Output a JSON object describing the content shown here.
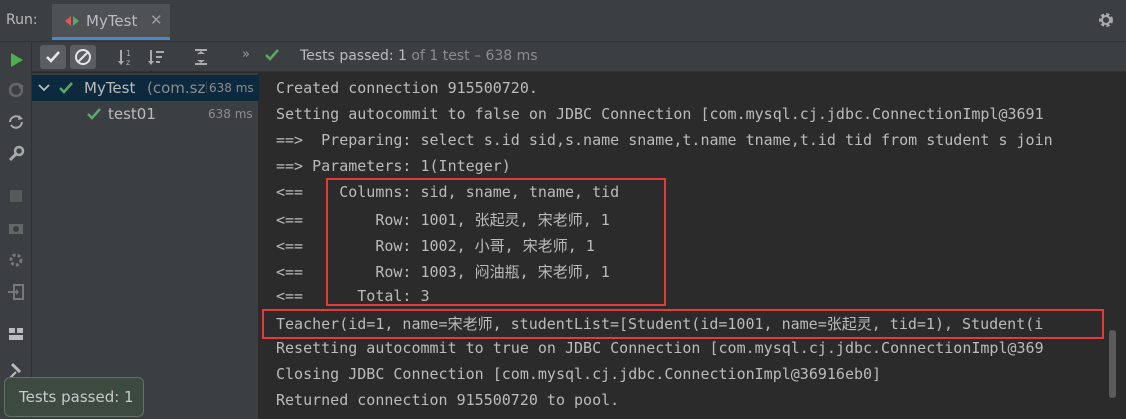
{
  "titlebar": {
    "run_label": "Run:",
    "tab_label": "MyTest",
    "tab_close": "✕"
  },
  "status": {
    "more": "»",
    "strong": "Tests passed:",
    "middle": " 1 ",
    "tail": "of 1 test – 638 ms"
  },
  "tree": {
    "root": {
      "label": "MyTest",
      "pkg": "(com.szh",
      "time": "638 ms"
    },
    "child": {
      "label": "test01",
      "time": "638 ms"
    }
  },
  "console": {
    "lines": [
      "Created connection 915500720.",
      "Setting autocommit to false on JDBC Connection [com.mysql.cj.jdbc.ConnectionImpl@3691",
      "==>  Preparing: select s.id sid,s.name sname,t.name tname,t.id tid from student s join",
      "==> Parameters: 1(Integer)",
      "<==    Columns: sid, sname, tname, tid",
      "<==        Row: 1001, 张起灵, 宋老师, 1",
      "<==        Row: 1002, 小哥, 宋老师, 1",
      "<==        Row: 1003, 闷油瓶, 宋老师, 1",
      "<==      Total: 3",
      "Teacher(id=1, name=宋老师, studentList=[Student(id=1001, name=张起灵, tid=1), Student(i",
      "Resetting autocommit to true on JDBC Connection [com.mysql.cj.jdbc.ConnectionImpl@369",
      "Closing JDBC Connection [com.mysql.cj.jdbc.ConnectionImpl@36916eb0]",
      "Returned connection 915500720 to pool."
    ]
  },
  "tooltip": {
    "text": "Tests passed: 1"
  },
  "colors": {
    "pass_green": "#59a869",
    "highlight_red": "#e23b3b",
    "run_green": "#4caf50"
  }
}
